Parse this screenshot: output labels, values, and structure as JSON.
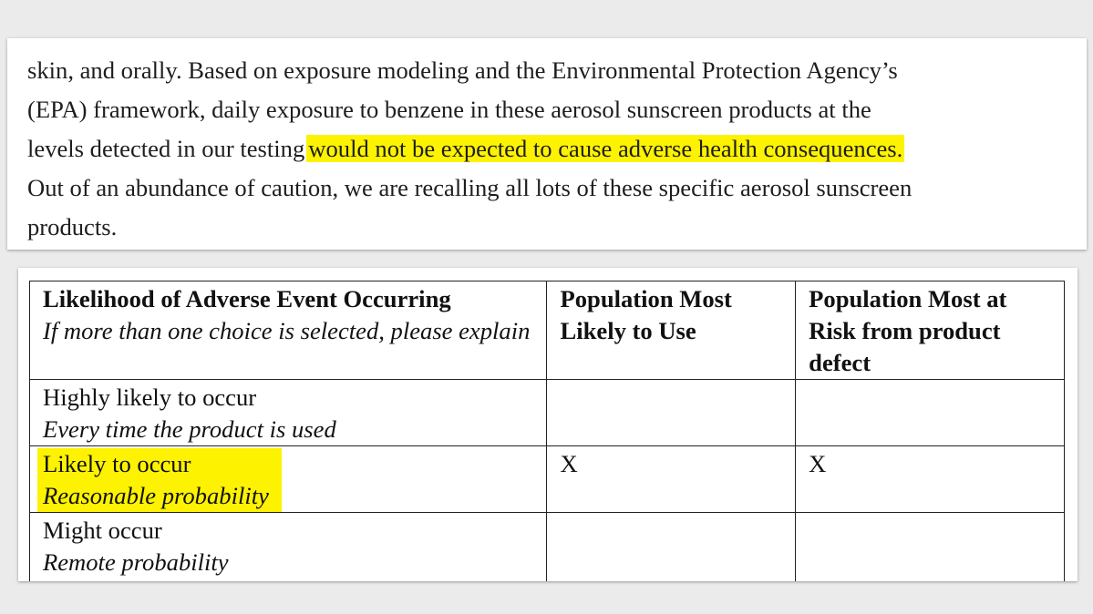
{
  "paragraph": {
    "line1": "skin, and orally. Based on exposure modeling and the Environmental Protection Agency’s",
    "line2": "(EPA) framework, daily exposure to benzene in these aerosol sunscreen products at the",
    "line3_plain": "levels detected in our testing",
    "line3_highlight": "would not be expected to cause adverse health consequences.",
    "line4": "Out of an abundance of caution, we are recalling all lots of these specific aerosol sunscreen",
    "line5": "products."
  },
  "table": {
    "headers": {
      "col1_title": "Likelihood of Adverse Event Occurring",
      "col1_note": "If more than one choice is selected, please explain",
      "col2": "Population Most Likely to Use",
      "col3": "Population Most at Risk from product defect"
    },
    "rows": [
      {
        "label": "Highly likely to occur",
        "sublabel": "Every time the product is used",
        "col2": "",
        "col3": "",
        "highlighted": false
      },
      {
        "label": "Likely to occur",
        "sublabel": "Reasonable probability",
        "col2": "X",
        "col3": "X",
        "highlighted": true
      },
      {
        "label": "Might occur",
        "sublabel": "Remote probability",
        "col2": "",
        "col3": "",
        "highlighted": false
      }
    ]
  },
  "colors": {
    "highlight": "#fdf301",
    "background": "#ebebeb",
    "text": "#1e1e1e"
  }
}
